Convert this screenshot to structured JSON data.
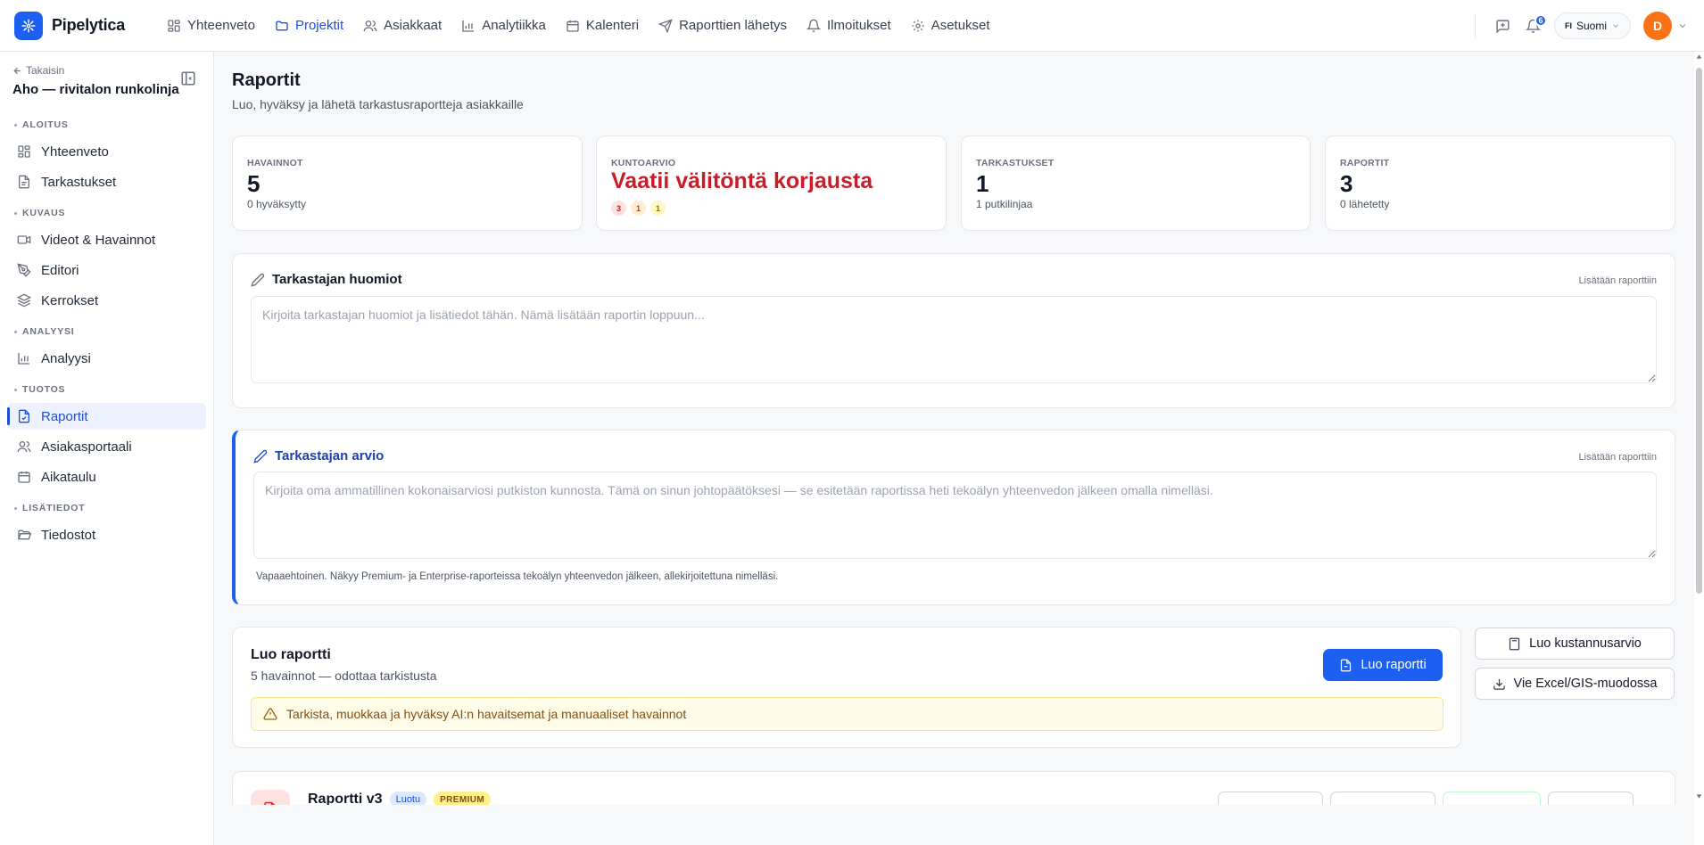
{
  "app": {
    "name": "Pipelytica"
  },
  "nav": {
    "items": [
      {
        "label": "Yhteenveto",
        "icon": "dashboard-icon"
      },
      {
        "label": "Projektit",
        "icon": "folder-icon",
        "active": true
      },
      {
        "label": "Asiakkaat",
        "icon": "users-icon"
      },
      {
        "label": "Analytiikka",
        "icon": "bar-chart-icon"
      },
      {
        "label": "Kalenteri",
        "icon": "calendar-icon"
      },
      {
        "label": "Raporttien lähetys",
        "icon": "send-icon"
      },
      {
        "label": "Ilmoitukset",
        "icon": "bell-icon"
      },
      {
        "label": "Asetukset",
        "icon": "gear-icon"
      }
    ]
  },
  "topbar": {
    "notifications_count": "6",
    "language_code": "FI",
    "language": "Suomi",
    "avatar_initial": "D"
  },
  "sidebar": {
    "back_label": "Takaisin",
    "project_name": "Aho — rivitalon runkolinja",
    "sections": [
      {
        "title": "ALOITUS",
        "items": [
          {
            "label": "Yhteenveto"
          },
          {
            "label": "Tarkastukset"
          }
        ]
      },
      {
        "title": "KUVAUS",
        "items": [
          {
            "label": "Videot & Havainnot"
          },
          {
            "label": "Editori"
          },
          {
            "label": "Kerrokset"
          }
        ]
      },
      {
        "title": "ANALYYSI",
        "items": [
          {
            "label": "Analyysi"
          }
        ]
      },
      {
        "title": "TUOTOS",
        "items": [
          {
            "label": "Raportit",
            "active": true
          },
          {
            "label": "Asiakasportaali"
          },
          {
            "label": "Aikataulu"
          }
        ]
      },
      {
        "title": "LISÄTIEDOT",
        "items": [
          {
            "label": "Tiedostot"
          }
        ]
      }
    ]
  },
  "page": {
    "title": "Raportit",
    "subtitle": "Luo, hyväksy ja lähetä tarkastusraportteja asiakkaille"
  },
  "stats": [
    {
      "label": "HAVAINNOT",
      "value": "5",
      "sub": "0 hyväksytty"
    },
    {
      "label": "KUNTOARVIO",
      "value": "Vaatii välitöntä korjausta",
      "severity": [
        "3",
        "1",
        "1"
      ]
    },
    {
      "label": "TARKASTUKSET",
      "value": "1",
      "sub": "1 putkilinjaa"
    },
    {
      "label": "RAPORTIT",
      "value": "3",
      "sub": "0 lähetetty"
    }
  ],
  "notes": {
    "title": "Tarkastajan huomiot",
    "hint": "Lisätään raporttiin",
    "value": "",
    "placeholder": "Kirjoita tarkastajan huomiot ja lisätiedot tähän. Nämä lisätään raportin loppuun..."
  },
  "assessment": {
    "title": "Tarkastajan arvio",
    "hint": "Lisätään raporttiin",
    "value": "",
    "placeholder": "Kirjoita oma ammatillinen kokonaisarviosi putkiston kunnosta. Tämä on sinun johtopäätöksesi — se esitetään raportissa heti tekoälyn yhteenvedon jälkeen omalla nimelläsi.",
    "help": "Vapaaehtoinen. Näkyy Premium- ja Enterprise-raporteissa tekoälyn yhteenvedon jälkeen, allekirjoitettuna nimelläsi."
  },
  "create": {
    "title": "Luo raportti",
    "status": "5 havainnot — odottaa tarkistusta",
    "button": "Luo raportti",
    "warning": "Tarkista, muokkaa ja hyväksy AI:n havaitsemat ja manuaaliset havainnot"
  },
  "side_actions": {
    "estimate": "Luo kustannusarvio",
    "export": "Vie Excel/GIS-muodossa"
  },
  "report": {
    "title": "Raportti v3",
    "status": "Luotu",
    "tier": "PREMIUM"
  },
  "colors": {
    "primary": "#1d5ff0",
    "danger": "#c81e2a",
    "warning_bg": "#fefce8"
  }
}
